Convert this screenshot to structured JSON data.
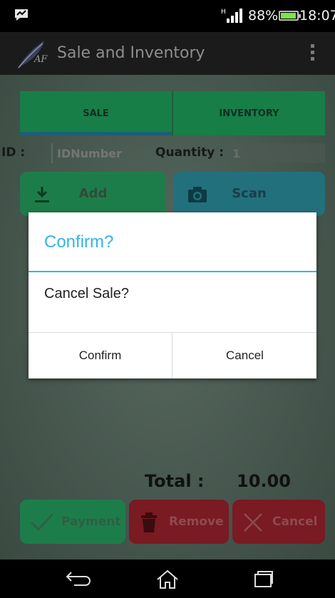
{
  "status": {
    "signal": "H",
    "battery": "88%",
    "time": "18:07"
  },
  "appbar": {
    "title": "Sale and Inventory",
    "logo_text": "AF"
  },
  "tabs": [
    {
      "label": "SALE",
      "active": true
    },
    {
      "label": "INVENTORY",
      "active": false
    }
  ],
  "form": {
    "id_label": "ID :",
    "id_placeholder": "IDNumber",
    "qty_label": "Quantity :",
    "qty_value": "1"
  },
  "actions": {
    "add": "Add",
    "scan": "Scan"
  },
  "total": {
    "label": "Total :",
    "value": "10.00"
  },
  "bottom_buttons": {
    "payment": "Payment",
    "remove": "Remove",
    "cancel": "Cancel"
  },
  "dialog": {
    "title": "Confirm?",
    "message": "Cancel Sale?",
    "confirm": "Confirm",
    "cancel": "Cancel"
  },
  "colors": {
    "accent": "#33b5e5",
    "green": "#1d7d4a",
    "red": "#7a1a22",
    "teal": "#23707d"
  }
}
